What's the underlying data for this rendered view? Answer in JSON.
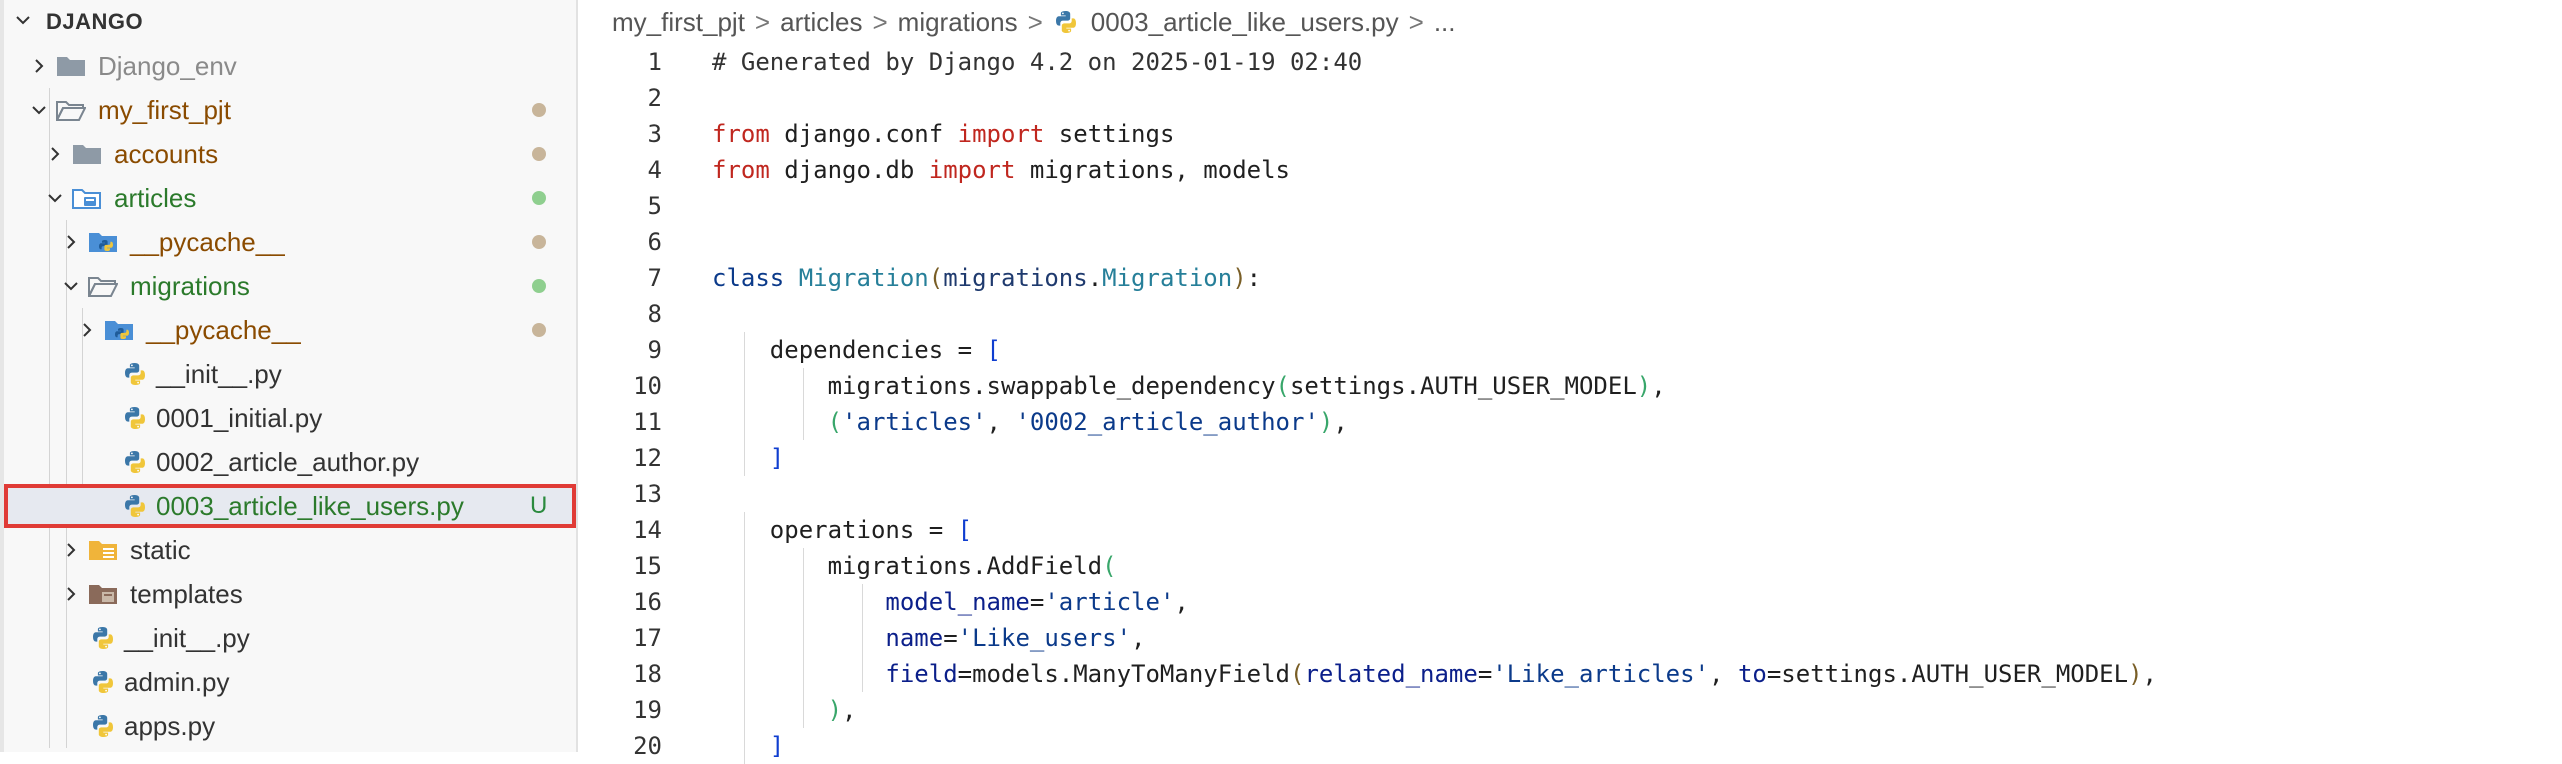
{
  "explorer": {
    "section_title": "DJANGO",
    "items": [
      {
        "label": "Django_env",
        "kind": "folder",
        "expanded": false,
        "status": "none",
        "color": "#8a8a8a"
      },
      {
        "label": "my_first_pjt",
        "kind": "folder-open",
        "expanded": true,
        "status": "modified",
        "color": "#8a4b00"
      },
      {
        "label": "accounts",
        "kind": "folder",
        "expanded": false,
        "status": "modified",
        "color": "#8a4b00"
      },
      {
        "label": "articles",
        "kind": "folder-open-special",
        "expanded": true,
        "status": "untracked",
        "color": "#2b7a2b"
      },
      {
        "label": "__pycache__",
        "kind": "folder-python",
        "expanded": false,
        "status": "modified",
        "color": "#8a4b00"
      },
      {
        "label": "migrations",
        "kind": "folder-open",
        "expanded": true,
        "status": "untracked",
        "color": "#2b7a2b"
      },
      {
        "label": "__pycache__",
        "kind": "folder-python",
        "expanded": false,
        "status": "modified",
        "color": "#8a4b00"
      },
      {
        "label": "__init__.py",
        "kind": "python",
        "status": "none",
        "color": "#333333"
      },
      {
        "label": "0001_initial.py",
        "kind": "python",
        "status": "none",
        "color": "#333333"
      },
      {
        "label": "0002_article_author.py",
        "kind": "python",
        "status": "none",
        "color": "#333333"
      },
      {
        "label": "0003_article_like_users.py",
        "kind": "python",
        "status": "U",
        "color": "#2b7a2b",
        "selected": true
      },
      {
        "label": "static",
        "kind": "folder-static",
        "expanded": false,
        "status": "none",
        "color": "#333333"
      },
      {
        "label": "templates",
        "kind": "folder-templates",
        "expanded": false,
        "status": "none",
        "color": "#333333"
      },
      {
        "label": "__init__.py",
        "kind": "python",
        "status": "none",
        "color": "#333333"
      },
      {
        "label": "admin.py",
        "kind": "python",
        "status": "none",
        "color": "#333333"
      },
      {
        "label": "apps.py",
        "kind": "python",
        "status": "none",
        "color": "#333333"
      }
    ]
  },
  "breadcrumb": {
    "parts": [
      "my_first_pjt",
      "articles",
      "migrations"
    ],
    "file": "0003_article_like_users.py",
    "tail": "..."
  },
  "editor": {
    "lines": [
      {
        "n": "1",
        "tokens": [
          [
            "cmt",
            "# Generated by Django 4.2 on 2025-01-19 02:40"
          ]
        ]
      },
      {
        "n": "2",
        "tokens": []
      },
      {
        "n": "3",
        "tokens": [
          [
            "kw",
            "from"
          ],
          [
            "",
            " django.conf "
          ],
          [
            "kw",
            "import"
          ],
          [
            "",
            " settings"
          ]
        ]
      },
      {
        "n": "4",
        "tokens": [
          [
            "kw",
            "from"
          ],
          [
            "",
            " django.db "
          ],
          [
            "kw",
            "import"
          ],
          [
            "",
            " migrations, models"
          ]
        ]
      },
      {
        "n": "5",
        "tokens": []
      },
      {
        "n": "6",
        "tokens": []
      },
      {
        "n": "7",
        "tokens": [
          [
            "kw2",
            "class"
          ],
          [
            "",
            " "
          ],
          [
            "cls",
            "Migration"
          ],
          [
            "br1",
            "("
          ],
          [
            "attr",
            "migrations"
          ],
          [
            "",
            "."
          ],
          [
            "cls",
            "Migration"
          ],
          [
            "br1",
            ")"
          ],
          [
            "",
            ":"
          ]
        ]
      },
      {
        "n": "8",
        "tokens": []
      },
      {
        "n": "9",
        "tokens": [
          [
            "",
            "    dependencies = "
          ],
          [
            "br2",
            "["
          ]
        ]
      },
      {
        "n": "10",
        "tokens": [
          [
            "",
            "        migrations.swappable_dependency"
          ],
          [
            "br3",
            "("
          ],
          [
            "",
            "settings.AUTH_USER_MODEL"
          ],
          [
            "br3",
            ")"
          ],
          [
            "",
            ","
          ]
        ]
      },
      {
        "n": "11",
        "tokens": [
          [
            "",
            "        "
          ],
          [
            "br3",
            "("
          ],
          [
            "str",
            "'articles'"
          ],
          [
            "",
            ", "
          ],
          [
            "str",
            "'0002_article_author'"
          ],
          [
            "br3",
            ")"
          ],
          [
            "",
            ","
          ]
        ]
      },
      {
        "n": "12",
        "tokens": [
          [
            "",
            "    "
          ],
          [
            "br2",
            "]"
          ]
        ]
      },
      {
        "n": "13",
        "tokens": []
      },
      {
        "n": "14",
        "tokens": [
          [
            "",
            "    operations = "
          ],
          [
            "br2",
            "["
          ]
        ]
      },
      {
        "n": "15",
        "tokens": [
          [
            "",
            "        migrations.AddField"
          ],
          [
            "br3",
            "("
          ]
        ]
      },
      {
        "n": "16",
        "tokens": [
          [
            "",
            "            "
          ],
          [
            "prm",
            "model_name"
          ],
          [
            "",
            "="
          ],
          [
            "str",
            "'article'"
          ],
          [
            "",
            ","
          ]
        ]
      },
      {
        "n": "17",
        "tokens": [
          [
            "",
            "            "
          ],
          [
            "prm",
            "name"
          ],
          [
            "",
            "="
          ],
          [
            "str",
            "'Like_users'"
          ],
          [
            "",
            ","
          ]
        ]
      },
      {
        "n": "18",
        "tokens": [
          [
            "",
            "            "
          ],
          [
            "prm",
            "field"
          ],
          [
            "",
            "=models.ManyToManyField"
          ],
          [
            "br1",
            "("
          ],
          [
            "prm",
            "related_name"
          ],
          [
            "",
            "="
          ],
          [
            "str",
            "'Like_articles'"
          ],
          [
            "",
            ", "
          ],
          [
            "prm",
            "to"
          ],
          [
            "",
            "=settings.AUTH_USER_MODEL"
          ],
          [
            "br1",
            ")"
          ],
          [
            "",
            ","
          ]
        ]
      },
      {
        "n": "19",
        "tokens": [
          [
            "",
            "        "
          ],
          [
            "br3",
            ")"
          ],
          [
            "",
            ","
          ]
        ]
      },
      {
        "n": "20",
        "tokens": [
          [
            "",
            "    "
          ],
          [
            "br2",
            "]"
          ]
        ]
      }
    ]
  },
  "colors": {
    "modified_dot": "#c8b59a",
    "untracked_dot": "#8fcf8f",
    "selection_border": "#e03b36",
    "selection_bg": "#e6e9f0"
  }
}
